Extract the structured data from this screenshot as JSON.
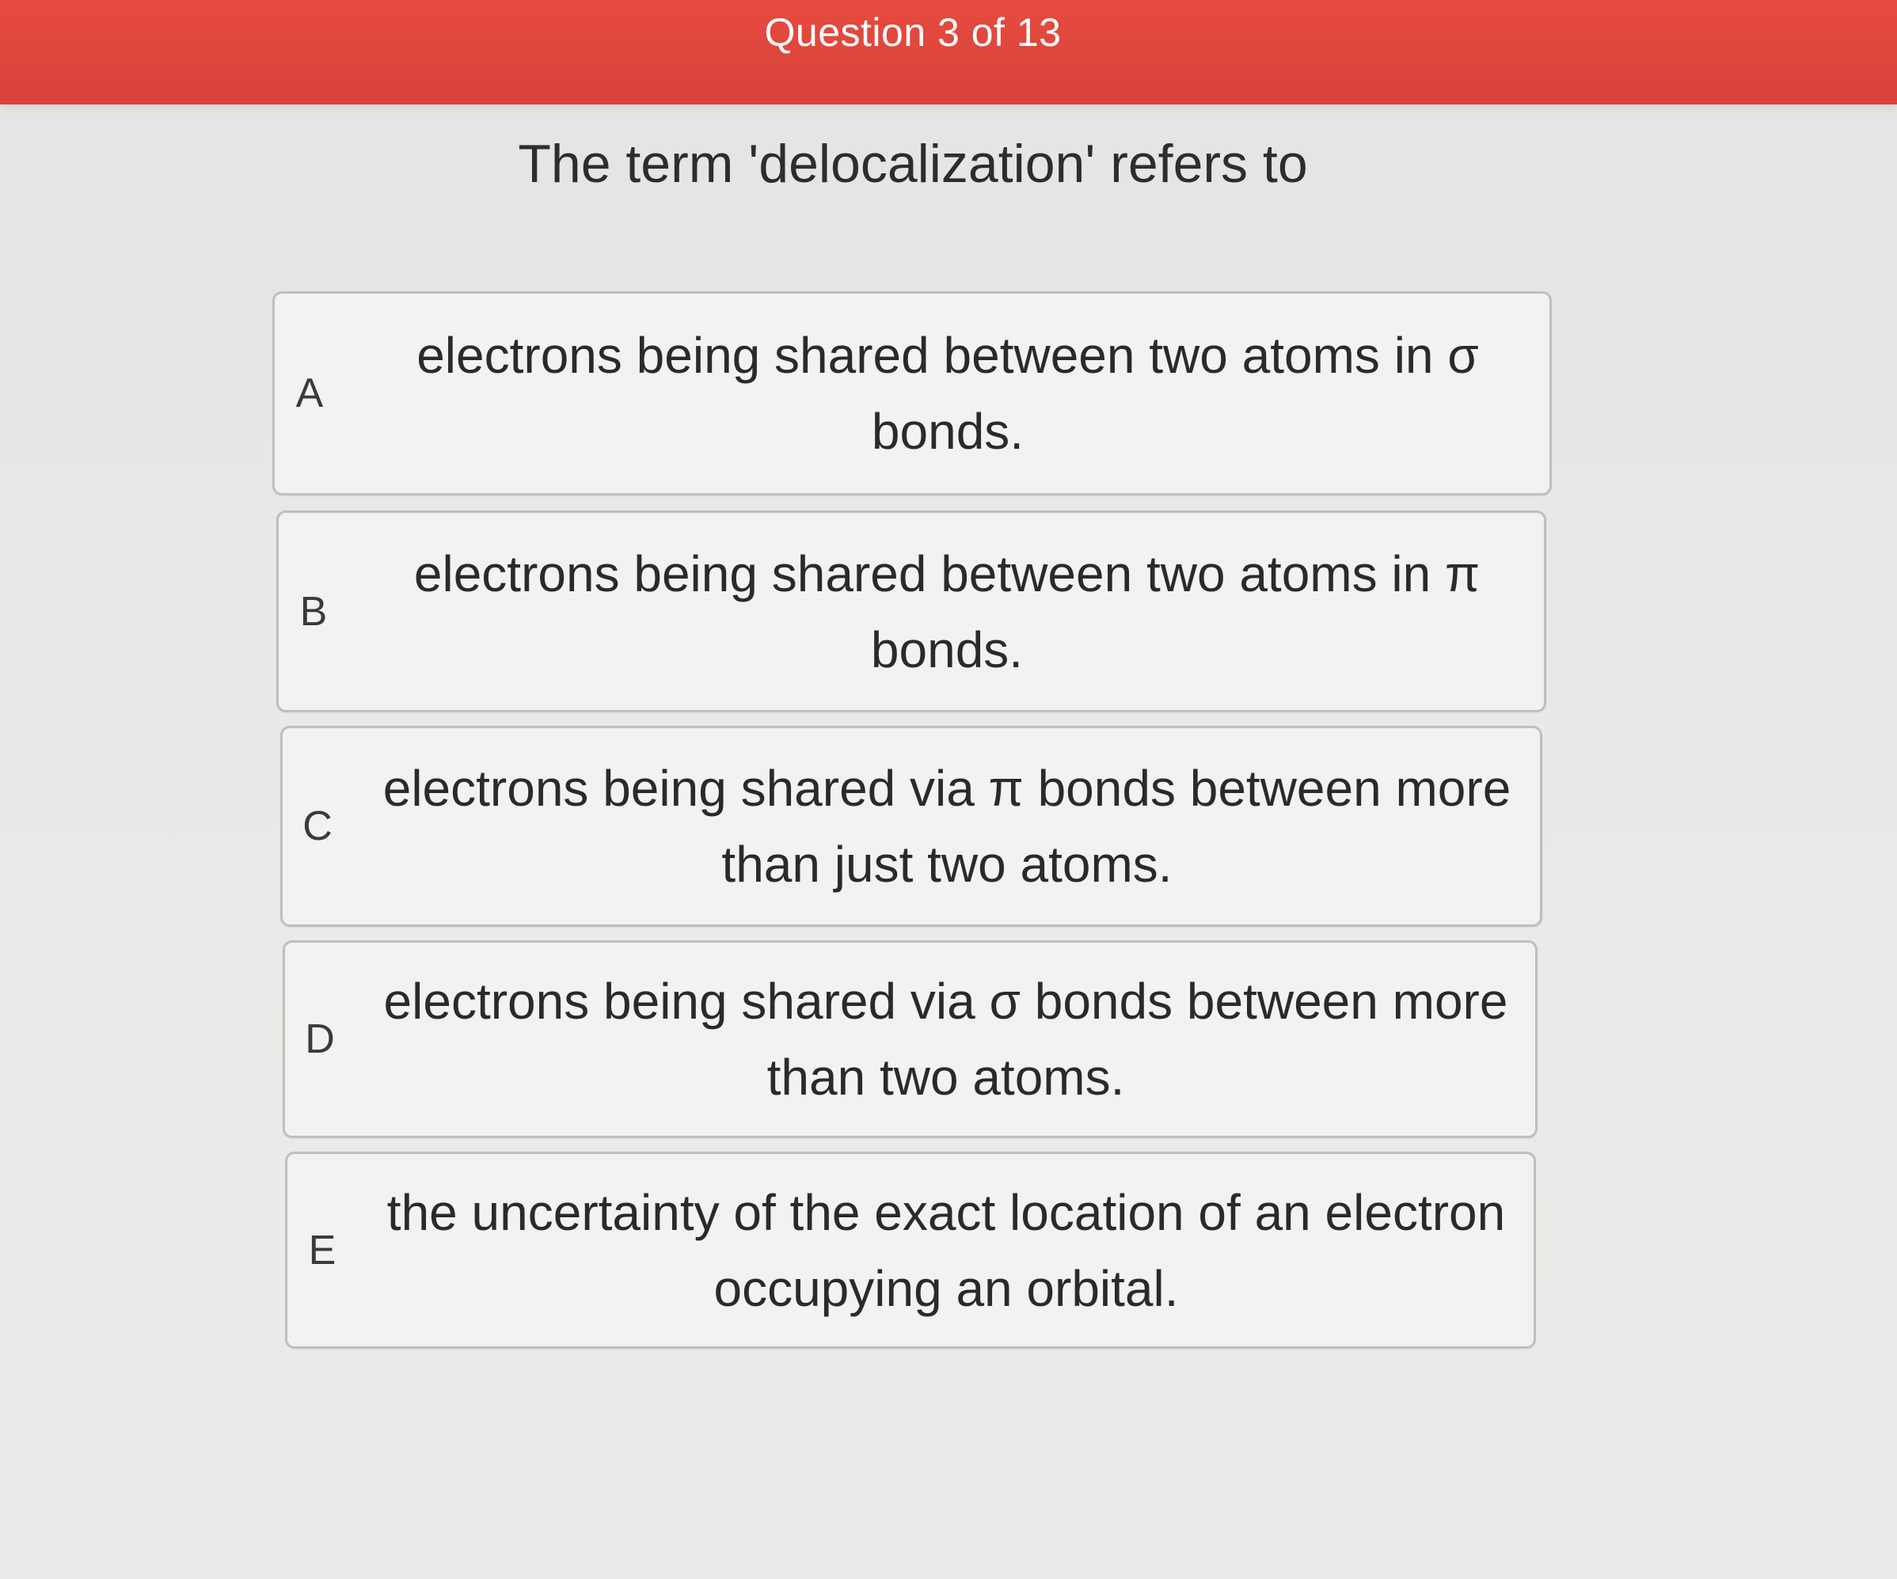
{
  "header": {
    "title": "Question 3 of 13"
  },
  "question": {
    "prompt": "The term 'delocalization' refers to"
  },
  "choices": [
    {
      "letter": "A",
      "text": "electrons being shared between two atoms in σ bonds."
    },
    {
      "letter": "B",
      "text": "electrons being shared between two atoms in π bonds."
    },
    {
      "letter": "C",
      "text": "electrons being shared via π bonds between more than just two atoms."
    },
    {
      "letter": "D",
      "text": "electrons being shared via σ bonds between more than two atoms."
    },
    {
      "letter": "E",
      "text": "the uncertainty of the exact location of an electron occupying an orbital."
    }
  ],
  "colors": {
    "header_bg": "#e64b3f",
    "page_bg": "#e9e9e7",
    "choice_bg": "#f2f2f0",
    "choice_border": "#bfbfbd"
  }
}
